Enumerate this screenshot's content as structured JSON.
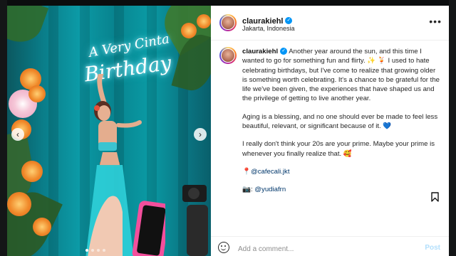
{
  "post": {
    "username": "claurakiehl",
    "location": "Jakarta, Indonesia",
    "more_label": "•••",
    "verified_mark": "✓"
  },
  "photo": {
    "neon_line1": "A Very Cinta",
    "neon_line2": "Birthday",
    "prev_label": "‹",
    "next_label": "›"
  },
  "caption": {
    "username": "claurakiehl",
    "paragraph1": "Another year around the sun, and this time I wanted to go for something fun and flirty. ✨ 🍹 I used to hate celebrating birthdays, but I've come to realize that growing older is something worth celebrating. It's a chance to be grateful for the life we've been given, the experiences that have shaped us and the privilege of getting to live another year.",
    "paragraph2": "Aging is a blessing, and no one should ever be made to feel less beautiful, relevant, or significant because of it. 💙",
    "paragraph3": "I really don't think your 20s are your prime. Maybe your prime is whenever you finally realize that. 🥰",
    "location_pin": "📍",
    "location_tag": "@cafecali.jkt",
    "camera_icon": "📷",
    "camera_label": ":",
    "photographer_tag": "@yudiafrn"
  },
  "comment": {
    "placeholder": "Add a comment...",
    "post_label": "Post"
  },
  "colors": {
    "verified": "#0095f6",
    "link": "#00376b",
    "post_disabled": "#b2dffc"
  }
}
